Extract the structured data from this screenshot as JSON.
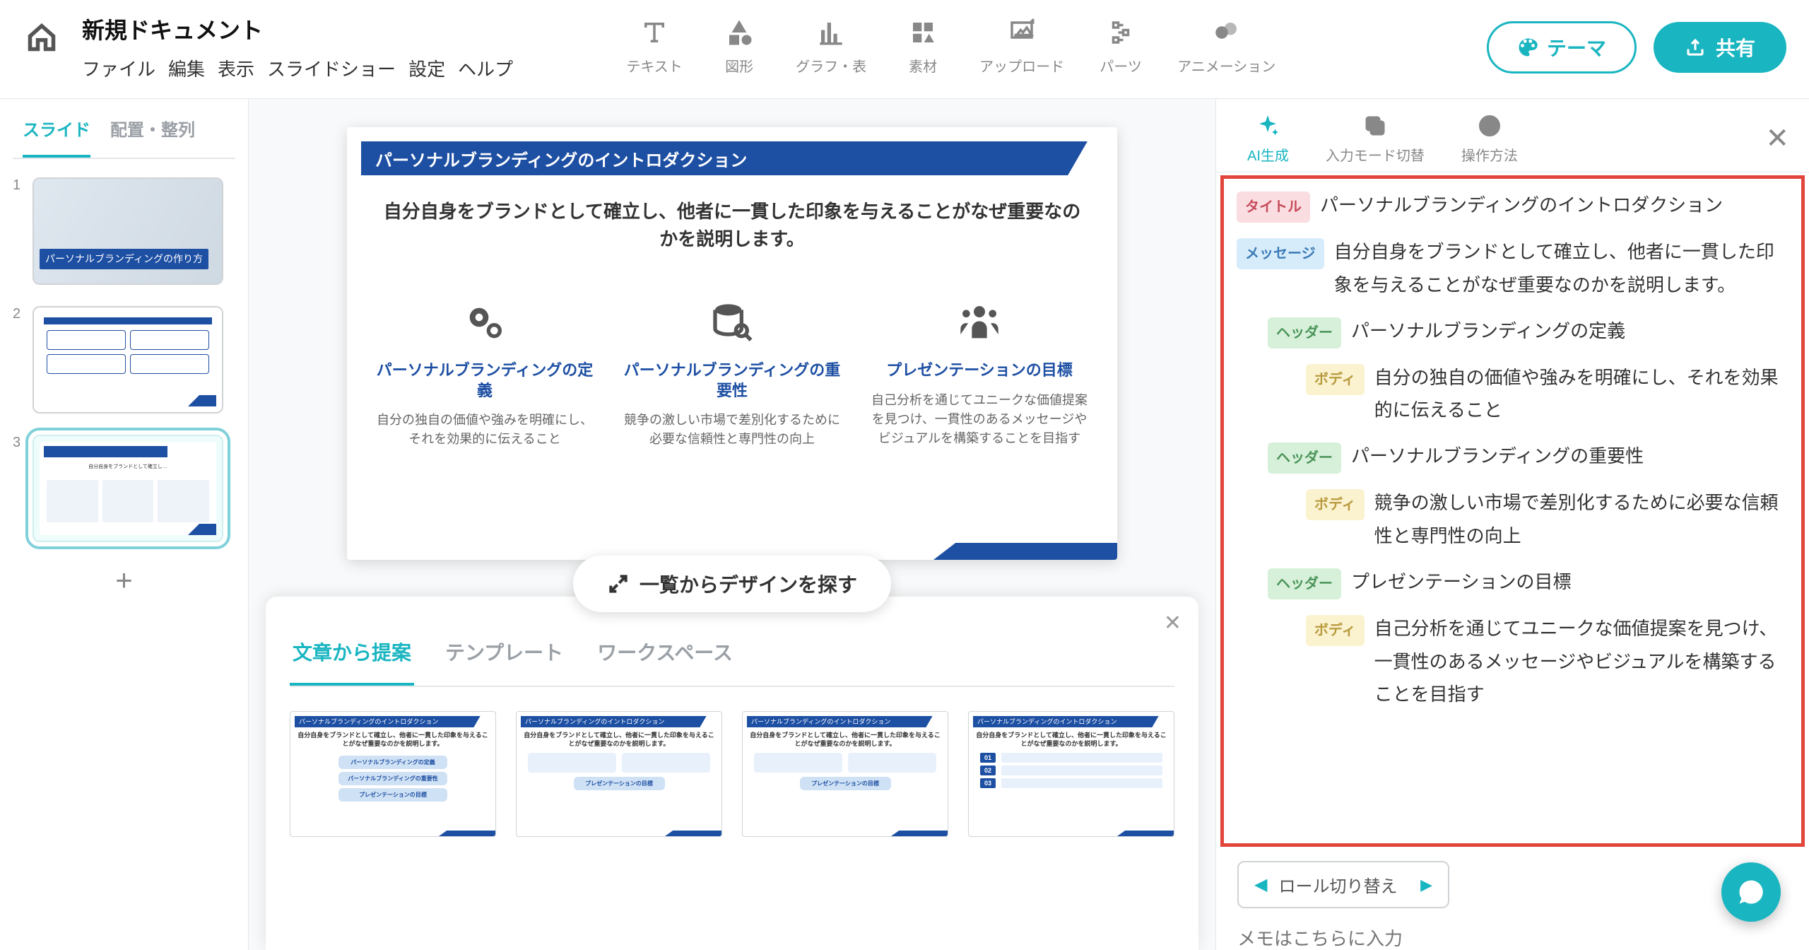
{
  "header": {
    "doc_title": "新規ドキュメント",
    "menu": {
      "file": "ファイル",
      "edit": "編集",
      "view": "表示",
      "slideshow": "スライドショー",
      "settings": "設定",
      "help": "ヘルプ"
    },
    "tools": {
      "text": "テキスト",
      "shape": "図形",
      "chart": "グラフ・表",
      "asset": "素材",
      "upload": "アップロード",
      "parts": "パーツ",
      "animation": "アニメーション"
    },
    "theme_btn": "テーマ",
    "share_btn": "共有"
  },
  "sidebar": {
    "tab_slides": "スライド",
    "tab_arrange": "配置・整列",
    "thumb1_caption": "パーソナルブランディングの作り方",
    "add_label": "+"
  },
  "slide": {
    "title": "パーソナルブランディングのイントロダクション",
    "message": "自分自身をブランドとして確立し、他者に一貫した印象を与えることがなぜ重要なのかを説明します。",
    "cols": [
      {
        "h": "パーソナルブランディングの定義",
        "p": "自分の独自の価値や強みを明確にし、それを効果的に伝えること"
      },
      {
        "h": "パーソナルブランディングの重要性",
        "p": "競争の激しい市場で差別化するために必要な信頼性と専門性の向上"
      },
      {
        "h": "プレゼンテーションの目標",
        "p": "自己分析を通じてユニークな価値提案を見つけ、一貫性のあるメッセージやビジュアルを構築することを目指す"
      }
    ]
  },
  "find_design": "一覧からデザインを探す",
  "bottom_panel": {
    "tab_text": "文章から提案",
    "tab_template": "テンプレート",
    "tab_workspace": "ワークスペース",
    "tpl_title": "パーソナルブランディングのイントロダクション",
    "tpl_msg": "自分自身をブランドとして確立し、他者に一貫した印象を与えることがなぜ重要なのかを説明します。",
    "tpl_pills": [
      "パーソナルブランディングの定義",
      "パーソナルブランディングの重要性",
      "プレゼンテーションの目標"
    ]
  },
  "right_panel": {
    "tool_ai": "AI生成",
    "tool_input": "入力モード切替",
    "tool_howto": "操作方法",
    "tags": {
      "title": "タイトル",
      "message": "メッセージ",
      "header": "ヘッダー",
      "body": "ボディ"
    },
    "outline": {
      "title": "パーソナルブランディングのイントロダクション",
      "message": "自分自身をブランドとして確立し、他者に一貫した印象を与えることがなぜ重要なのかを説明します。",
      "sections": [
        {
          "header": "パーソナルブランディングの定義",
          "body": "自分の独自の価値や強みを明確にし、それを効果的に伝えること"
        },
        {
          "header": "パーソナルブランディングの重要性",
          "body": "競争の激しい市場で差別化するために必要な信頼性と専門性の向上"
        },
        {
          "header": "プレゼンテーションの目標",
          "body": "自己分析を通じてユニークな価値提案を見つけ、一貫性のあるメッセージやビジュアルを構築することを目指す"
        }
      ]
    },
    "role_switch": "ロール切り替え",
    "memo_placeholder": "メモはこちらに入力"
  }
}
